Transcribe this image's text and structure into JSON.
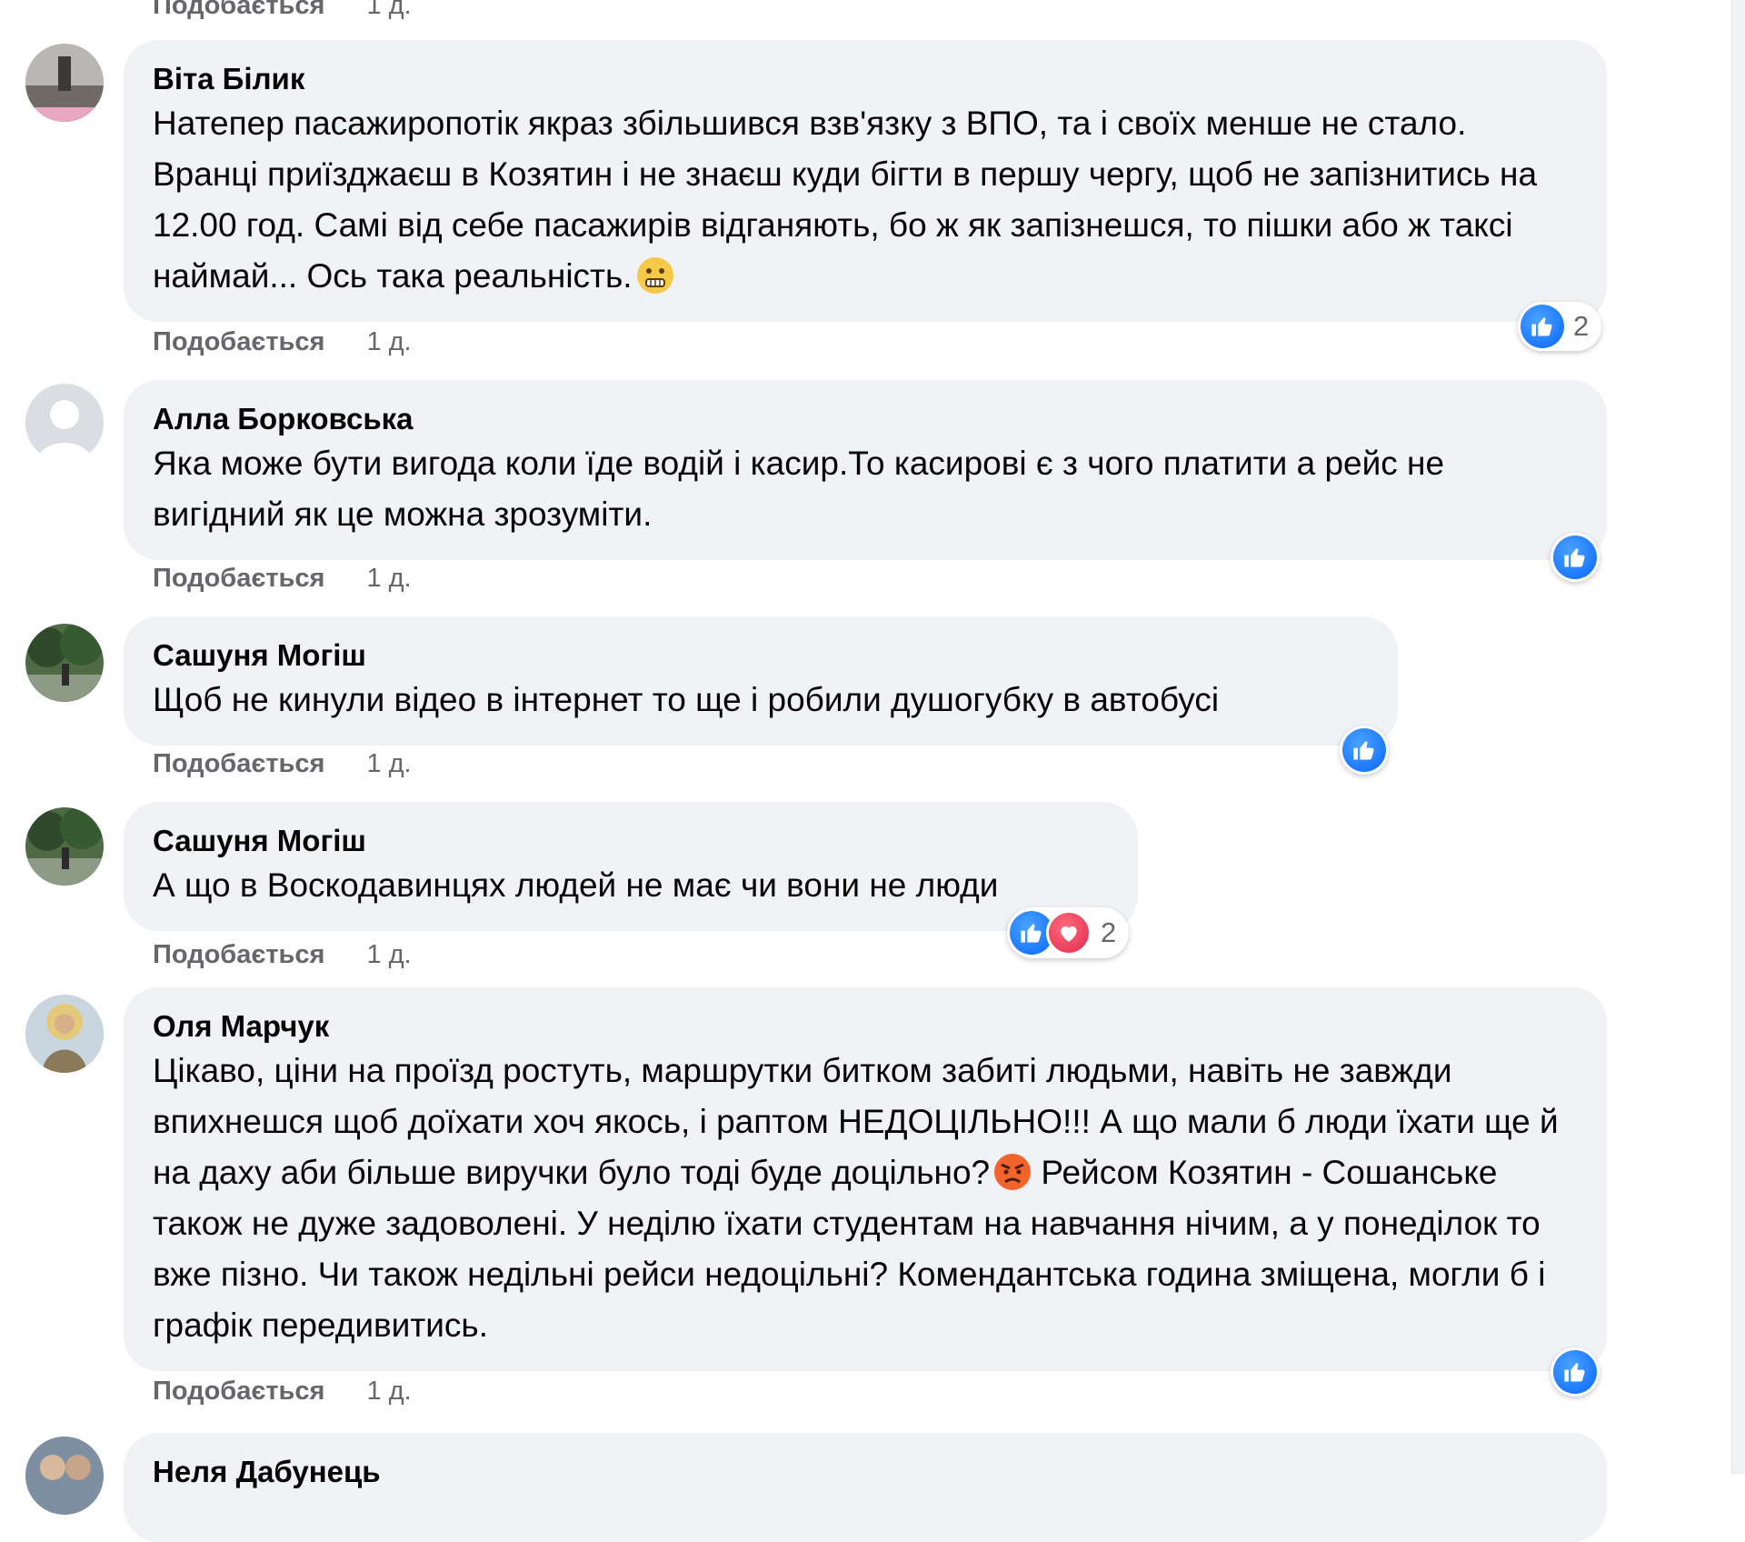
{
  "top_meta": {
    "like": "Подобається",
    "time": "1 д."
  },
  "comments": [
    {
      "author": "Віта Білик",
      "text": "Натепер пасажиропотік якраз збільшився взв'язку з ВПО, та і своїх менше не стало. Вранці приїзджаєш в Козятин і не знаєш куди бігти в першу чергу, щоб не запізнитись на 12.00 год. Самі від себе пасажирів відганяють, бо ж як запізнешся, то пішки або ж таксі наймай... Ось така реальність.",
      "like": "Подобається",
      "time": "1 д.",
      "reaction_count": "2"
    },
    {
      "author": "Алла Борковська",
      "text": "Яка може бути вигода коли їде водій і касир.То касирові є з чого платити а рейс не вигідний як це можна зрозуміти.",
      "like": "Подобається",
      "time": "1 д."
    },
    {
      "author": "Сашуня Могіш",
      "text": "Щоб не кинули відео в інтернет то ще і робили душогубку в автобусі",
      "like": "Подобається",
      "time": "1 д."
    },
    {
      "author": "Сашуня Могіш",
      "text": "А що в Воскодавинцях людей не має чи вони не люди",
      "like": "Подобається",
      "time": "1 д.",
      "reaction_count": "2"
    },
    {
      "author": "Оля Марчук",
      "text": "Цікаво, ціни на проїзд ростуть, маршрутки битком забиті людьми, навіть не завжди впихнешся щоб доїхати хоч якось, і раптом НЕДОЦІЛЬНО!!! А що мали б люди їхати ще й на даху аби більше виручки було тоді буде доцільно?",
      "text_2": "Рейсом Козятин - Сошанське також не дуже задоволені. У неділю їхати студентам на навчання нічим, а у понеділок то вже пізно. Чи також недільні рейси недоцільні? Комендантська година зміщена, могли б і графік передивитись.",
      "like": "Подобається",
      "time": "1 д."
    },
    {
      "author": "Неля Дабунець"
    }
  ],
  "colors": {
    "bubble": "#f0f2f5",
    "like_blue": "#0866ff",
    "love_red": "#e0294a",
    "meta_gray": "#65676b"
  },
  "icons": [
    "like-reaction-icon",
    "love-reaction-icon",
    "grimace-emoji-icon",
    "angry-emoji-icon"
  ]
}
